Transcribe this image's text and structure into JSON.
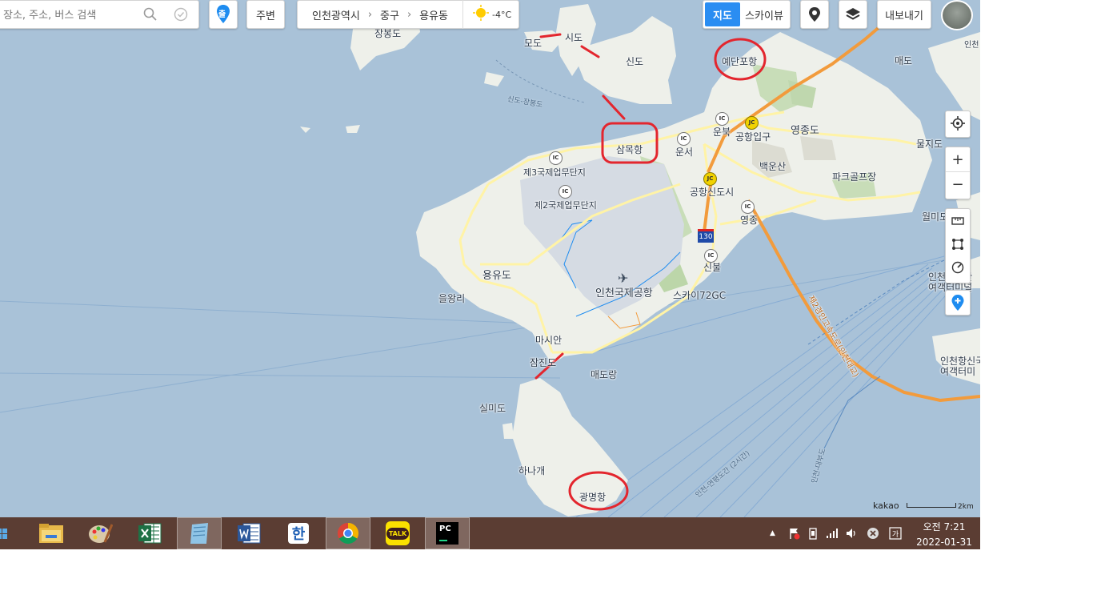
{
  "search": {
    "placeholder": "장소, 주소, 버스 검색"
  },
  "toolbar": {
    "start_marker": "출",
    "nearby": "주변",
    "breadcrumb": [
      "인천광역시",
      "중구",
      "용유동"
    ],
    "weather": "-4°C",
    "map_tab": "지도",
    "skyview_tab": "스카이뷰",
    "export": "내보내기"
  },
  "map": {
    "places": {
      "sindo": "신도",
      "sido": "시도",
      "modo": "모도",
      "jangbongdo": "장봉도",
      "yedanpohang": "예단포항",
      "sammokhang": "삼목항",
      "unseo": "운서",
      "unbuk": "운북",
      "airport_entrance": "공항입구",
      "yeongjongdo": "영종도",
      "baegunsan": "백운산",
      "parkgolf": "파크골프장",
      "muljido": "물지도",
      "maedo": "매도",
      "wolmido": "월미도",
      "industrial3": "제3국제업무단지",
      "industrial2": "제2국제업무단지",
      "airport_newcity": "공항신도시",
      "yeongjong": "영종",
      "sinbul": "신불",
      "yongyudo": "용유도",
      "eulwangri": "을왕리",
      "incheon_airport": "인천국제공항",
      "sky72": "스카이72GC",
      "masian": "마시안",
      "jamjindo": "잠진도",
      "maedorang": "매도랑",
      "silmido": "실미도",
      "hanagae": "하나개",
      "gwangmyeonghang": "광명항",
      "incheon_terminal_top": "인천항연안\n여객터미널",
      "incheon_terminal_bottom": "인천항신국\n여객터미",
      "ferry_route_top": "신도-장봉도",
      "ferry_route_bottom": "인천-연평도간 (2시간)",
      "bridge": "제2경인고속도로(인천대교)",
      "incheon_fragment": "인천",
      "route_incheon_deokjeok": "인천-대부도",
      "highway_number": "130"
    },
    "scale": {
      "brand": "kakao",
      "distance": "2km"
    }
  },
  "controls": {
    "zoom_in": "+",
    "zoom_out": "−"
  },
  "taskbar": {
    "clock_time": "오전 7:21",
    "clock_date": "2022-01-31",
    "apps": [
      "file-explorer",
      "paint",
      "excel",
      "notepad",
      "word",
      "hangul",
      "chrome",
      "kakaotalk",
      "pycharm"
    ],
    "talk_label": "TALK",
    "pc_label": "PC"
  },
  "colors": {
    "sea": "#a9c2d8",
    "land": "#eef0ea",
    "road_major": "#f29b3c",
    "highway_yellow": "#fff7c6",
    "airport": "#d5dbe3",
    "annotation_red": "#e3262e",
    "taskbar": "#5b3d33",
    "accent_blue": "#1e8cf0"
  }
}
